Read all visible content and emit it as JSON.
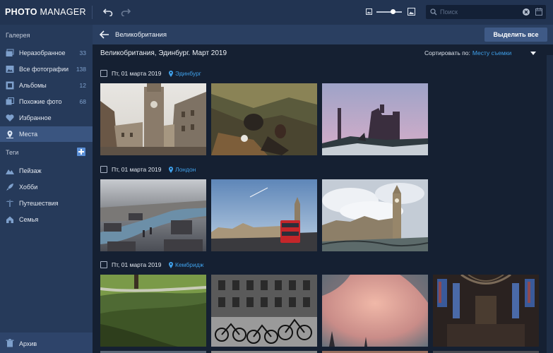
{
  "app": {
    "brand_bold": "PHOTO",
    "brand_light": " MANAGER"
  },
  "toolbar": {
    "undo_icon": "undo-icon",
    "redo_icon": "redo-icon",
    "zoom_level": 0.6
  },
  "search": {
    "placeholder": "Поиск"
  },
  "sidebar": {
    "gallery_title": "Галерея",
    "items": [
      {
        "label": "Неразобранное",
        "count": "33",
        "icon": "unsorted-icon"
      },
      {
        "label": "Все фотографии",
        "count": "138",
        "icon": "photos-icon"
      },
      {
        "label": "Альбомы",
        "count": "12",
        "icon": "albums-icon"
      },
      {
        "label": "Похожие фото",
        "count": "68",
        "icon": "similar-icon"
      },
      {
        "label": "Избранное",
        "count": "",
        "icon": "heart-icon"
      },
      {
        "label": "Места",
        "count": "",
        "icon": "map-pin-icon",
        "active": true
      }
    ],
    "tags_title": "Теги",
    "tags": [
      {
        "label": "Пейзаж",
        "icon": "landscape-icon"
      },
      {
        "label": "Хобби",
        "icon": "rocket-icon"
      },
      {
        "label": "Путешествия",
        "icon": "palm-icon"
      },
      {
        "label": "Семья",
        "icon": "home-icon"
      }
    ],
    "archive": "Архив"
  },
  "header": {
    "title": "Великобритания",
    "select_all": "Выделить все"
  },
  "content": {
    "subtitle": "Великобритания, Эдинбург. Март 2019",
    "sort_label": "Сортировать по:",
    "sort_value": "Месту съемки"
  },
  "groups": [
    {
      "date": "Пт, 01 марта 2019",
      "location": "Эдинбург"
    },
    {
      "date": "Пт, 01 марта 2019",
      "location": "Лондон"
    },
    {
      "date": "Пт, 01 марта 2019",
      "location": "Кембридж"
    }
  ],
  "colors": {
    "accent": "#3fa0ea",
    "sidebar": "#263a5a",
    "active": "#3a5580",
    "background": "#152032"
  }
}
